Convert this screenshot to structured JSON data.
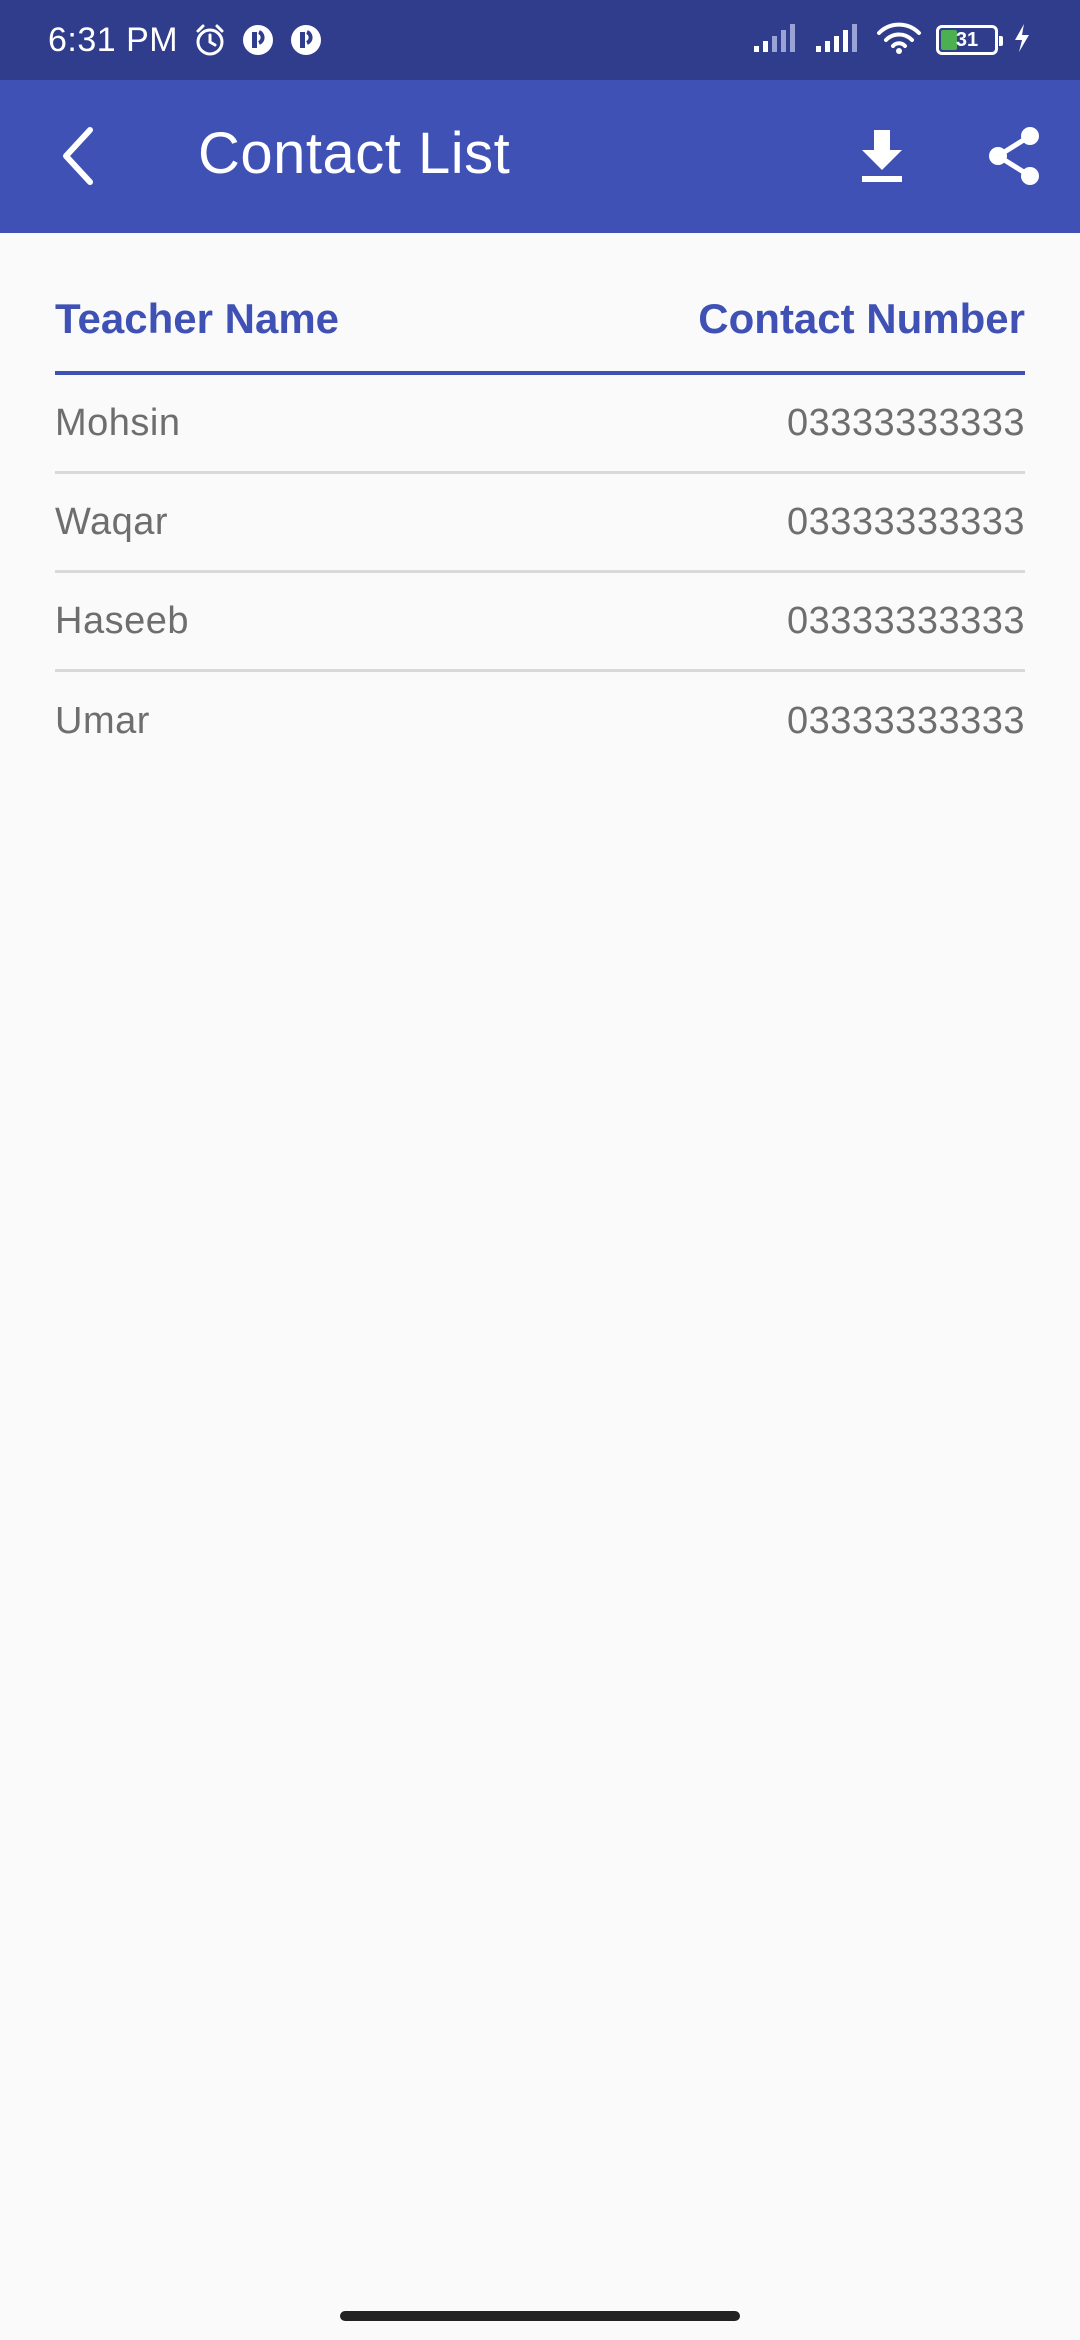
{
  "status_bar": {
    "time": "6:31 PM",
    "battery_level": "31",
    "battery_fill_fraction": 0.31,
    "icons": [
      "alarm-icon",
      "app-notification-icon",
      "app-notification-icon",
      "signal-icon",
      "signal-icon",
      "wifi-icon",
      "battery-icon",
      "charging-icon"
    ]
  },
  "app_bar": {
    "title": "Contact List",
    "back_icon": "back-arrow-icon",
    "actions": [
      "download-icon",
      "share-icon"
    ]
  },
  "table": {
    "columns": [
      "Teacher Name",
      "Contact Number"
    ],
    "rows": [
      {
        "name": "Mohsin",
        "number": "03333333333"
      },
      {
        "name": "Waqar",
        "number": "03333333333"
      },
      {
        "name": "Haseeb",
        "number": "03333333333"
      },
      {
        "name": "Umar",
        "number": "03333333333"
      }
    ]
  },
  "colors": {
    "status_bar": "#2f3d8c",
    "app_bar": "#3f51b5",
    "accent": "#3f51b5",
    "row_text": "#6e6e6e",
    "divider": "#d9d9d9",
    "background": "#fafafa"
  }
}
